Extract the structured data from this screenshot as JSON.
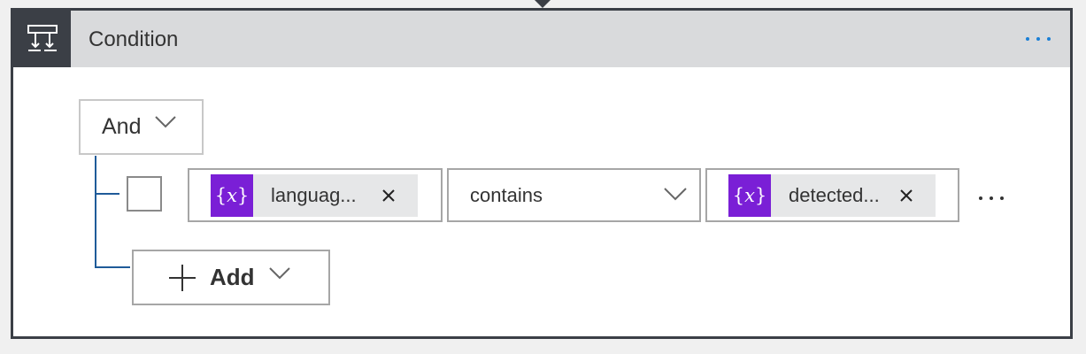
{
  "card": {
    "title": "Condition",
    "icon": "condition-icon",
    "more_icon": "ellipsis-icon",
    "more_label": "⋯"
  },
  "group": {
    "operator_label": "And"
  },
  "row": {
    "left_token": {
      "icon_open": "{",
      "icon_var": "x",
      "icon_close": "}",
      "label": "languag..."
    },
    "operator": "contains",
    "right_token": {
      "icon_open": "{",
      "icon_var": "x",
      "icon_close": "}",
      "label": "detected..."
    },
    "more_label": "···"
  },
  "add": {
    "label": "Add"
  },
  "colors": {
    "header_bg": "#d9dadc",
    "icon_bg": "#3b3f46",
    "token_icon": "#7a1fd6",
    "tree_line": "#1f5b99",
    "accent": "#1a7fd6"
  }
}
